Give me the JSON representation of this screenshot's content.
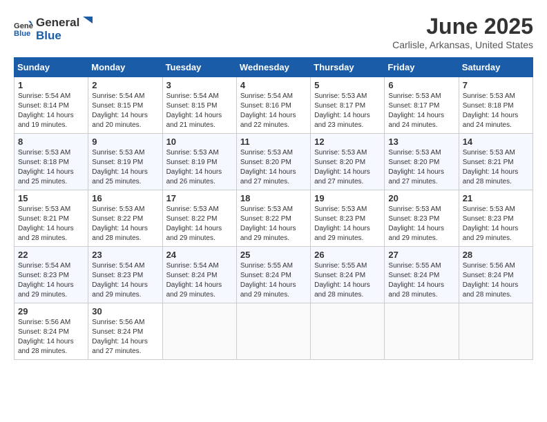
{
  "header": {
    "logo_general": "General",
    "logo_blue": "Blue",
    "month_title": "June 2025",
    "location": "Carlisle, Arkansas, United States"
  },
  "calendar": {
    "days_of_week": [
      "Sunday",
      "Monday",
      "Tuesday",
      "Wednesday",
      "Thursday",
      "Friday",
      "Saturday"
    ],
    "weeks": [
      [
        {
          "day": "1",
          "info": "Sunrise: 5:54 AM\nSunset: 8:14 PM\nDaylight: 14 hours\nand 19 minutes."
        },
        {
          "day": "2",
          "info": "Sunrise: 5:54 AM\nSunset: 8:15 PM\nDaylight: 14 hours\nand 20 minutes."
        },
        {
          "day": "3",
          "info": "Sunrise: 5:54 AM\nSunset: 8:15 PM\nDaylight: 14 hours\nand 21 minutes."
        },
        {
          "day": "4",
          "info": "Sunrise: 5:54 AM\nSunset: 8:16 PM\nDaylight: 14 hours\nand 22 minutes."
        },
        {
          "day": "5",
          "info": "Sunrise: 5:53 AM\nSunset: 8:17 PM\nDaylight: 14 hours\nand 23 minutes."
        },
        {
          "day": "6",
          "info": "Sunrise: 5:53 AM\nSunset: 8:17 PM\nDaylight: 14 hours\nand 24 minutes."
        },
        {
          "day": "7",
          "info": "Sunrise: 5:53 AM\nSunset: 8:18 PM\nDaylight: 14 hours\nand 24 minutes."
        }
      ],
      [
        {
          "day": "8",
          "info": "Sunrise: 5:53 AM\nSunset: 8:18 PM\nDaylight: 14 hours\nand 25 minutes."
        },
        {
          "day": "9",
          "info": "Sunrise: 5:53 AM\nSunset: 8:19 PM\nDaylight: 14 hours\nand 25 minutes."
        },
        {
          "day": "10",
          "info": "Sunrise: 5:53 AM\nSunset: 8:19 PM\nDaylight: 14 hours\nand 26 minutes."
        },
        {
          "day": "11",
          "info": "Sunrise: 5:53 AM\nSunset: 8:20 PM\nDaylight: 14 hours\nand 27 minutes."
        },
        {
          "day": "12",
          "info": "Sunrise: 5:53 AM\nSunset: 8:20 PM\nDaylight: 14 hours\nand 27 minutes."
        },
        {
          "day": "13",
          "info": "Sunrise: 5:53 AM\nSunset: 8:20 PM\nDaylight: 14 hours\nand 27 minutes."
        },
        {
          "day": "14",
          "info": "Sunrise: 5:53 AM\nSunset: 8:21 PM\nDaylight: 14 hours\nand 28 minutes."
        }
      ],
      [
        {
          "day": "15",
          "info": "Sunrise: 5:53 AM\nSunset: 8:21 PM\nDaylight: 14 hours\nand 28 minutes."
        },
        {
          "day": "16",
          "info": "Sunrise: 5:53 AM\nSunset: 8:22 PM\nDaylight: 14 hours\nand 28 minutes."
        },
        {
          "day": "17",
          "info": "Sunrise: 5:53 AM\nSunset: 8:22 PM\nDaylight: 14 hours\nand 29 minutes."
        },
        {
          "day": "18",
          "info": "Sunrise: 5:53 AM\nSunset: 8:22 PM\nDaylight: 14 hours\nand 29 minutes."
        },
        {
          "day": "19",
          "info": "Sunrise: 5:53 AM\nSunset: 8:23 PM\nDaylight: 14 hours\nand 29 minutes."
        },
        {
          "day": "20",
          "info": "Sunrise: 5:53 AM\nSunset: 8:23 PM\nDaylight: 14 hours\nand 29 minutes."
        },
        {
          "day": "21",
          "info": "Sunrise: 5:53 AM\nSunset: 8:23 PM\nDaylight: 14 hours\nand 29 minutes."
        }
      ],
      [
        {
          "day": "22",
          "info": "Sunrise: 5:54 AM\nSunset: 8:23 PM\nDaylight: 14 hours\nand 29 minutes."
        },
        {
          "day": "23",
          "info": "Sunrise: 5:54 AM\nSunset: 8:23 PM\nDaylight: 14 hours\nand 29 minutes."
        },
        {
          "day": "24",
          "info": "Sunrise: 5:54 AM\nSunset: 8:24 PM\nDaylight: 14 hours\nand 29 minutes."
        },
        {
          "day": "25",
          "info": "Sunrise: 5:55 AM\nSunset: 8:24 PM\nDaylight: 14 hours\nand 29 minutes."
        },
        {
          "day": "26",
          "info": "Sunrise: 5:55 AM\nSunset: 8:24 PM\nDaylight: 14 hours\nand 28 minutes."
        },
        {
          "day": "27",
          "info": "Sunrise: 5:55 AM\nSunset: 8:24 PM\nDaylight: 14 hours\nand 28 minutes."
        },
        {
          "day": "28",
          "info": "Sunrise: 5:56 AM\nSunset: 8:24 PM\nDaylight: 14 hours\nand 28 minutes."
        }
      ],
      [
        {
          "day": "29",
          "info": "Sunrise: 5:56 AM\nSunset: 8:24 PM\nDaylight: 14 hours\nand 28 minutes."
        },
        {
          "day": "30",
          "info": "Sunrise: 5:56 AM\nSunset: 8:24 PM\nDaylight: 14 hours\nand 27 minutes."
        },
        {
          "day": "",
          "info": ""
        },
        {
          "day": "",
          "info": ""
        },
        {
          "day": "",
          "info": ""
        },
        {
          "day": "",
          "info": ""
        },
        {
          "day": "",
          "info": ""
        }
      ]
    ]
  }
}
